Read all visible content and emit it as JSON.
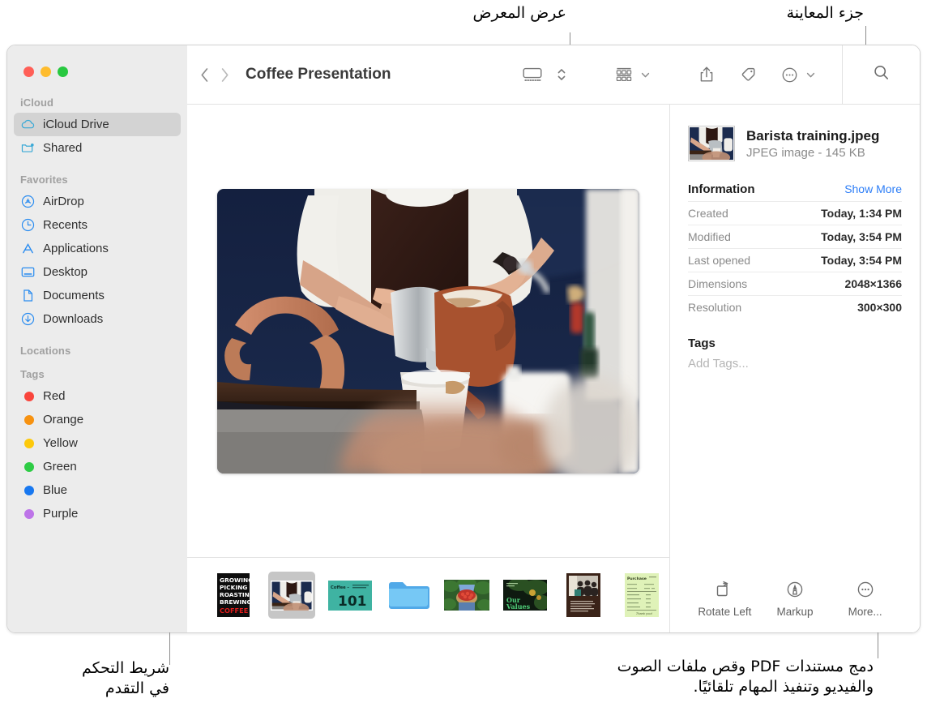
{
  "annotations": {
    "gallery_view": "عرض المعرض",
    "preview_pane": "جزء المعاينة",
    "progress_bar": "شريط التحكم\nفي التقدم",
    "bottom_right": "دمج مستندات PDF وقص ملفات الصوت\nوالفيديو وتنفيذ المهام تلقائيًا."
  },
  "window": {
    "title": "Coffee Presentation",
    "traffic_lights": [
      "close",
      "minimize",
      "zoom"
    ]
  },
  "toolbar": {
    "back_icon": "chevron-left-icon",
    "forward_icon": "chevron-right-icon",
    "view_gallery_icon": "gallery-view-icon",
    "view_stepper_icon": "chevron-up-down-icon",
    "group_icon": "group-by-icon",
    "group_chevron_icon": "chevron-down-icon",
    "share_icon": "share-icon",
    "tag_icon": "tag-icon",
    "more_icon": "ellipsis-circle-icon",
    "more_chevron_icon": "chevron-down-icon",
    "search_icon": "search-icon"
  },
  "sidebar": {
    "sections": [
      {
        "header": "iCloud",
        "items": [
          {
            "label": "iCloud Drive",
            "icon": "cloud-icon",
            "selected": true
          },
          {
            "label": "Shared",
            "icon": "shared-folder-icon",
            "selected": false
          }
        ]
      },
      {
        "header": "Favorites",
        "items": [
          {
            "label": "AirDrop",
            "icon": "airdrop-icon",
            "selected": false
          },
          {
            "label": "Recents",
            "icon": "clock-icon",
            "selected": false
          },
          {
            "label": "Applications",
            "icon": "applications-icon",
            "selected": false
          },
          {
            "label": "Desktop",
            "icon": "desktop-icon",
            "selected": false
          },
          {
            "label": "Documents",
            "icon": "document-icon",
            "selected": false
          },
          {
            "label": "Downloads",
            "icon": "download-icon",
            "selected": false
          }
        ]
      },
      {
        "header": "Locations",
        "items": []
      },
      {
        "header": "Tags",
        "items": [
          {
            "label": "Red",
            "icon": "tag-dot",
            "color": "#f9453c",
            "selected": false
          },
          {
            "label": "Orange",
            "icon": "tag-dot",
            "color": "#f79210",
            "selected": false
          },
          {
            "label": "Yellow",
            "icon": "tag-dot",
            "color": "#fdc90b",
            "selected": false
          },
          {
            "label": "Green",
            "icon": "tag-dot",
            "color": "#2ecc45",
            "selected": false
          },
          {
            "label": "Blue",
            "icon": "tag-dot",
            "color": "#1878f0",
            "selected": false
          },
          {
            "label": "Purple",
            "icon": "tag-dot",
            "color": "#bd74e8",
            "selected": false
          }
        ]
      }
    ]
  },
  "gallery": {
    "hero_alt": "barista-pouring-coffee",
    "thumbnails": [
      {
        "name": "growing-picking-roasting-brewing-coffee-poster",
        "selected": false
      },
      {
        "name": "barista-training-photo",
        "selected": true
      },
      {
        "name": "coffee-101-slide",
        "selected": false
      },
      {
        "name": "folder",
        "selected": false
      },
      {
        "name": "coffee-cherries-basket-photo",
        "selected": false
      },
      {
        "name": "our-values-slide",
        "selected": false
      },
      {
        "name": "meeting-document",
        "selected": false
      },
      {
        "name": "purchase-form-document",
        "selected": false
      }
    ]
  },
  "preview": {
    "file_name": "Barista training.jpeg",
    "file_meta": "JPEG image - 145 KB",
    "information_title": "Information",
    "show_more": "Show More",
    "info_rows": [
      {
        "key": "Created",
        "value": "Today, 1:34 PM"
      },
      {
        "key": "Modified",
        "value": "Today, 3:54 PM"
      },
      {
        "key": "Last opened",
        "value": "Today, 3:54 PM"
      },
      {
        "key": "Dimensions",
        "value": "2048×1366"
      },
      {
        "key": "Resolution",
        "value": "300×300"
      }
    ],
    "tags_title": "Tags",
    "tags_placeholder": "Add Tags...",
    "actions": [
      {
        "label": "Rotate Left",
        "icon": "rotate-left-icon"
      },
      {
        "label": "Markup",
        "icon": "markup-icon"
      },
      {
        "label": "More...",
        "icon": "ellipsis-circle-icon"
      }
    ]
  },
  "colors": {
    "accent_blue": "#2a8cf0",
    "link_blue": "#2d7ef7",
    "sidebar_bg": "#ececec",
    "selection_bg": "#d3d3d3"
  }
}
